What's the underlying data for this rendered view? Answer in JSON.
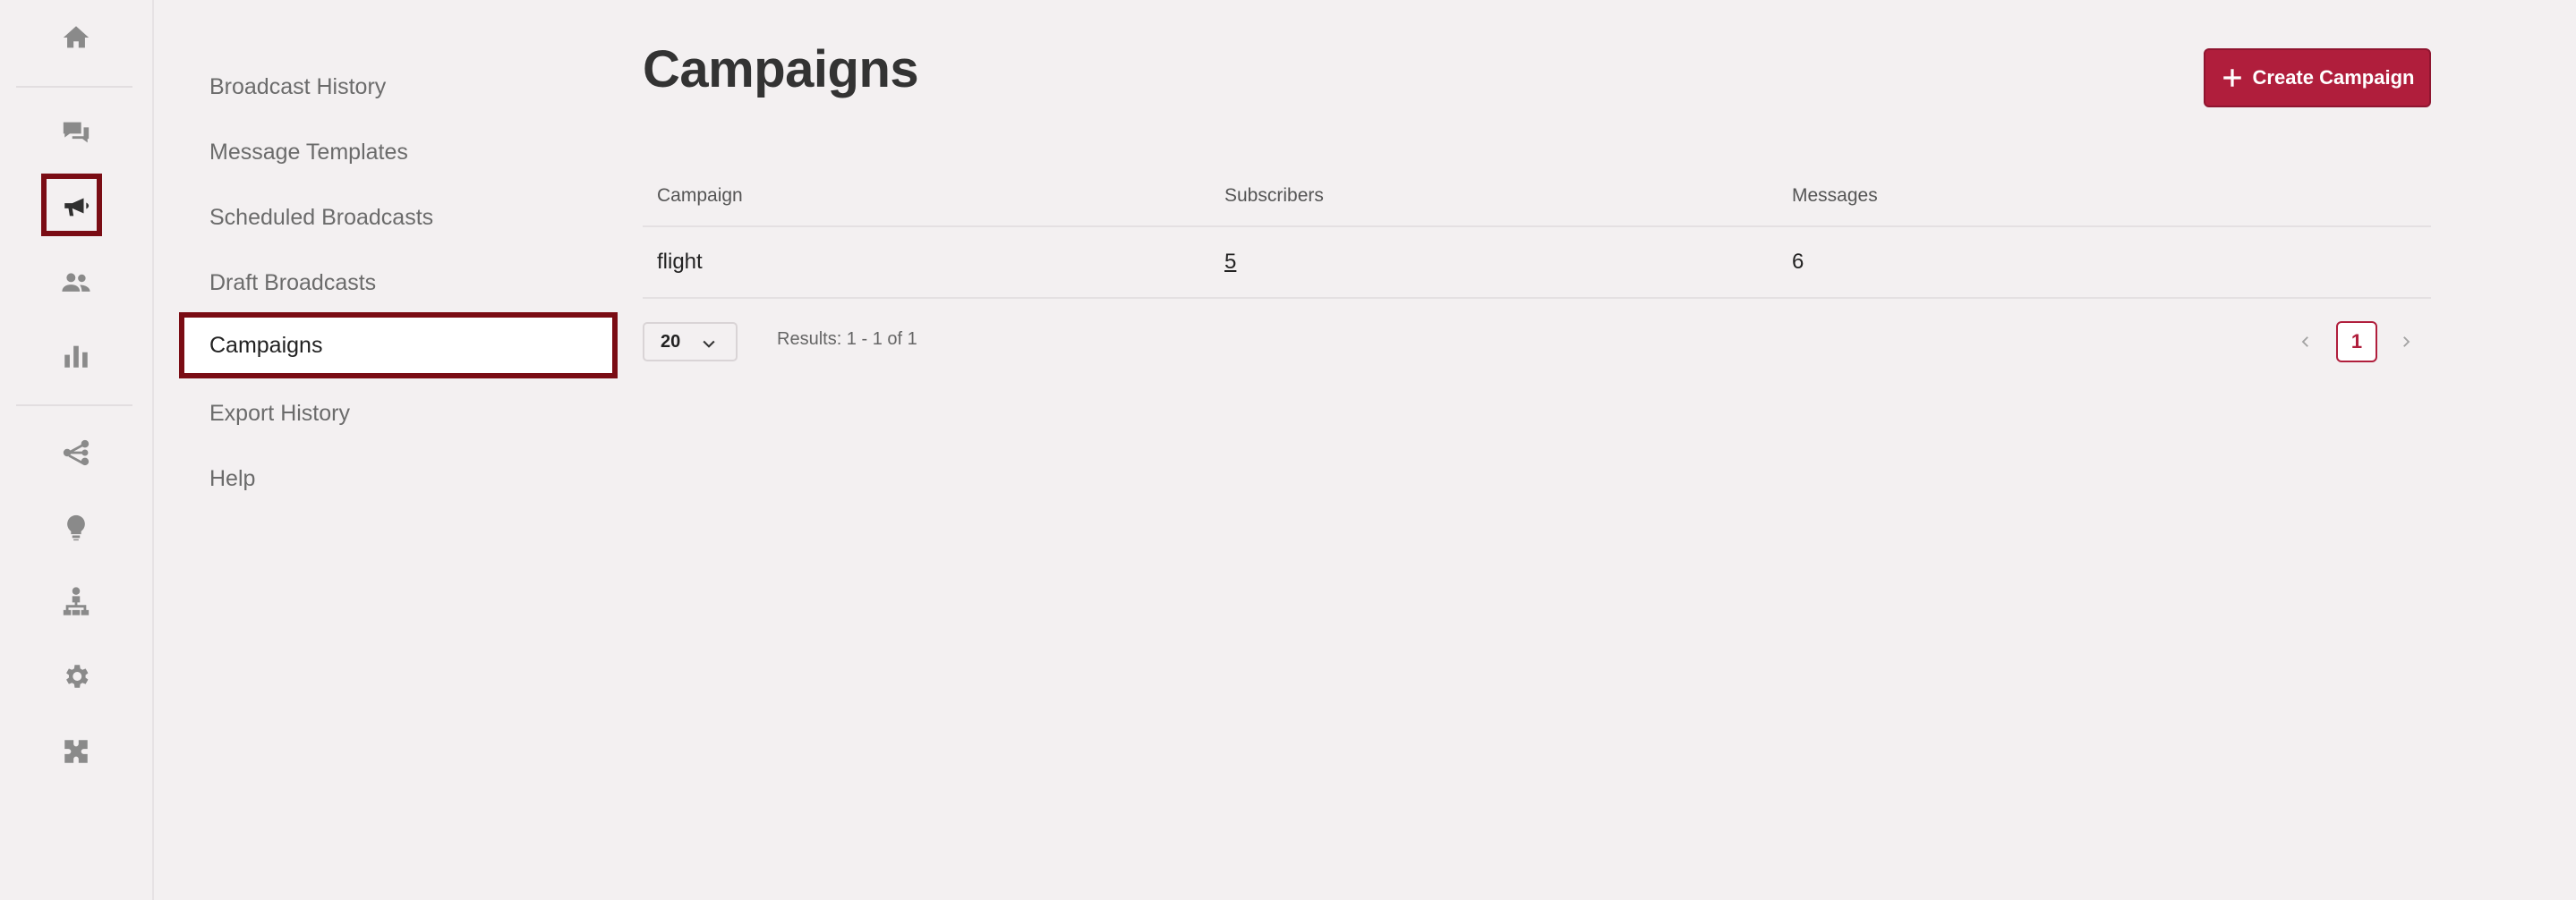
{
  "rail": {
    "icons": [
      "home-icon",
      "chat-icon",
      "megaphone-icon",
      "users-icon",
      "bar-chart-icon",
      "share-nodes-icon",
      "lightbulb-icon",
      "sitemap-icon",
      "gear-icon",
      "puzzle-icon"
    ],
    "active": "megaphone-icon"
  },
  "subnav": {
    "items": [
      {
        "label": "Broadcast History"
      },
      {
        "label": "Message Templates"
      },
      {
        "label": "Scheduled Broadcasts"
      },
      {
        "label": "Draft Broadcasts"
      },
      {
        "label": "Campaigns"
      },
      {
        "label": "Export History"
      },
      {
        "label": "Help"
      }
    ],
    "active": "Campaigns"
  },
  "main": {
    "title": "Campaigns",
    "create_button_label": "Create Campaign",
    "table": {
      "headers": [
        "Campaign",
        "Subscribers",
        "Messages"
      ],
      "rows": [
        {
          "campaign": "flight",
          "subscribers": "5",
          "messages": "6"
        }
      ]
    },
    "pagination": {
      "page_size": "20",
      "results_text": "Results: 1 - 1 of 1",
      "current_page": "1"
    }
  },
  "colors": {
    "accent": "#b01e3c",
    "highlight_border": "#7a0c14",
    "background": "#f3f0f1"
  }
}
